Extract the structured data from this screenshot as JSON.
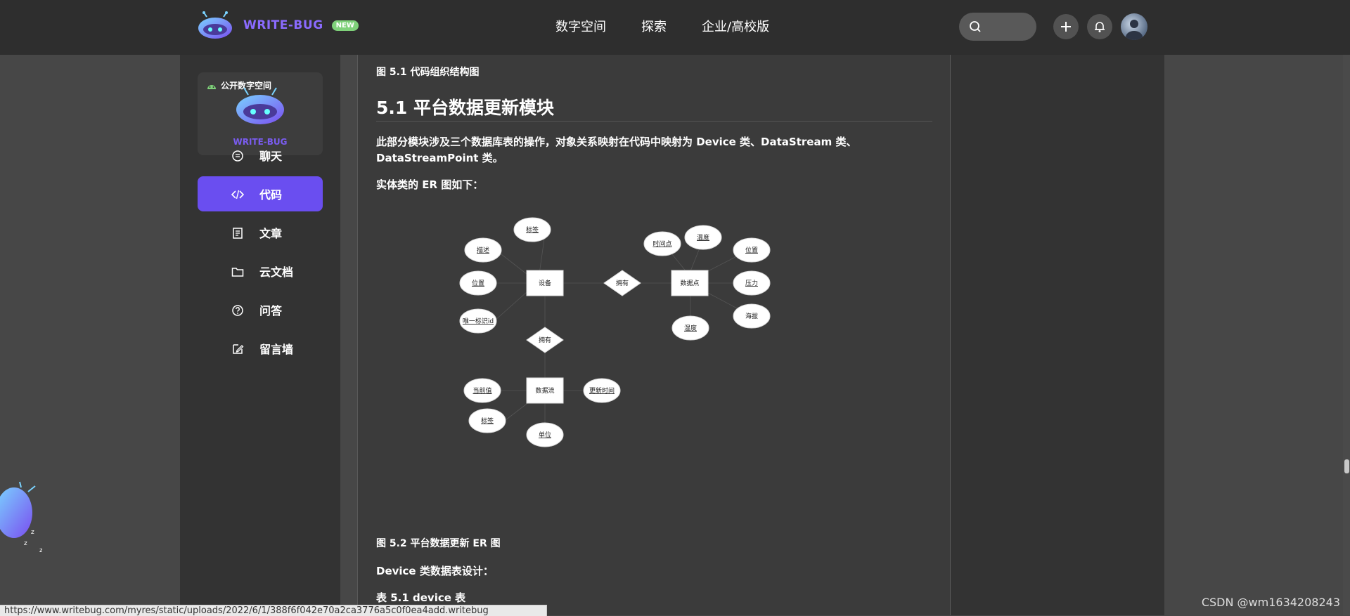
{
  "header": {
    "logo_text": "WRITE-BUG",
    "badge": "NEW",
    "nav": [
      "数字空间",
      "探索",
      "企业/高校版"
    ],
    "icons": [
      "search-icon",
      "plus-icon",
      "bell-icon",
      "avatar"
    ]
  },
  "sidebar": {
    "card_label": "公开数字空间",
    "card_brand": "WRITE-BUG",
    "items": [
      {
        "label": "聊天",
        "icon": "chat-icon"
      },
      {
        "label": "代码",
        "icon": "code-icon",
        "active": true
      },
      {
        "label": "文章",
        "icon": "article-icon"
      },
      {
        "label": "云文档",
        "icon": "folder-icon"
      },
      {
        "label": "问答",
        "icon": "question-icon"
      },
      {
        "label": "留言墙",
        "icon": "edit-icon"
      }
    ]
  },
  "article": {
    "fig_caption_1": "图 5.1 代码组织结构图",
    "section_title": "5.1 平台数据更新模块",
    "para_line1": "此部分模块涉及三个数据库表的操作，对象关系映射在代码中映射为 Device 类、DataStream 类、",
    "para_line2": "DataStreamPoint 类。",
    "er_intro": "实体类的 ER 图如下：",
    "fig_caption_2": "图 5.2 平台数据更新 ER 图",
    "table_intro": "Device 类数据表设计：",
    "table_caption": "表 5.1 device 表"
  },
  "er_diagram": {
    "entities": [
      "设备",
      "数据点",
      "数据流"
    ],
    "relations": [
      "拥有",
      "拥有"
    ],
    "device_attrs": [
      "标签",
      "描述",
      "位置",
      "唯一标识id"
    ],
    "datapoint_attrs": [
      "时间点",
      "温度",
      "位置",
      "压力",
      "海拔",
      "湿度"
    ],
    "datastream_attrs": [
      "当前值",
      "更新时间",
      "标签",
      "单位"
    ]
  },
  "status": {
    "url": "https://www.writebug.com/myres/static/uploads/2022/6/1/388f6f042e70a2ca3776a5c0f0ea4add.writebug",
    "watermark": "CSDN @wm1634208243"
  },
  "colors": {
    "accent": "#6a4ef0",
    "topbar": "#2e2e2e",
    "content_bg": "#3b3b3b",
    "panel_bg": "#333333"
  }
}
